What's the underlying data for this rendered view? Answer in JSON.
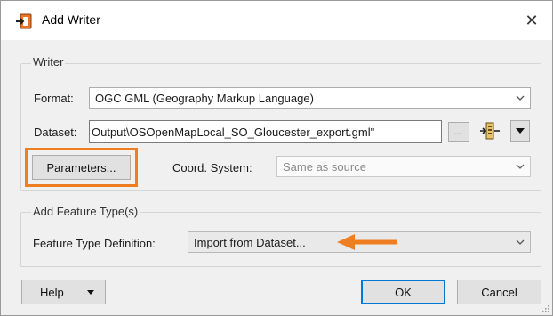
{
  "window": {
    "title": "Add Writer",
    "close_glyph": "✕"
  },
  "writer_group": {
    "title": "Writer",
    "format_label": "Format:",
    "format_value": "OGC GML (Geography Markup Language)",
    "dataset_label": "Dataset:",
    "dataset_value": "Output\\OSOpenMapLocal_SO_Gloucester_export.gml\"",
    "browse_label": "...",
    "parameters_label": "Parameters...",
    "coord_label": "Coord. System:",
    "coord_value": "Same as source"
  },
  "feature_group": {
    "title": "Add Feature Type(s)",
    "definition_label": "Feature Type Definition:",
    "definition_value": "Import from Dataset..."
  },
  "footer": {
    "help_label": "Help",
    "ok_label": "OK",
    "cancel_label": "Cancel"
  },
  "colors": {
    "highlight": "#ef7d22",
    "accent": "#0078d7"
  },
  "icons": [
    "writer-icon",
    "close-icon",
    "chevron-down-icon",
    "dataset-options-icon",
    "dropdown-arrow-icon",
    "annotation-arrow-icon",
    "resize-grip-icon"
  ]
}
